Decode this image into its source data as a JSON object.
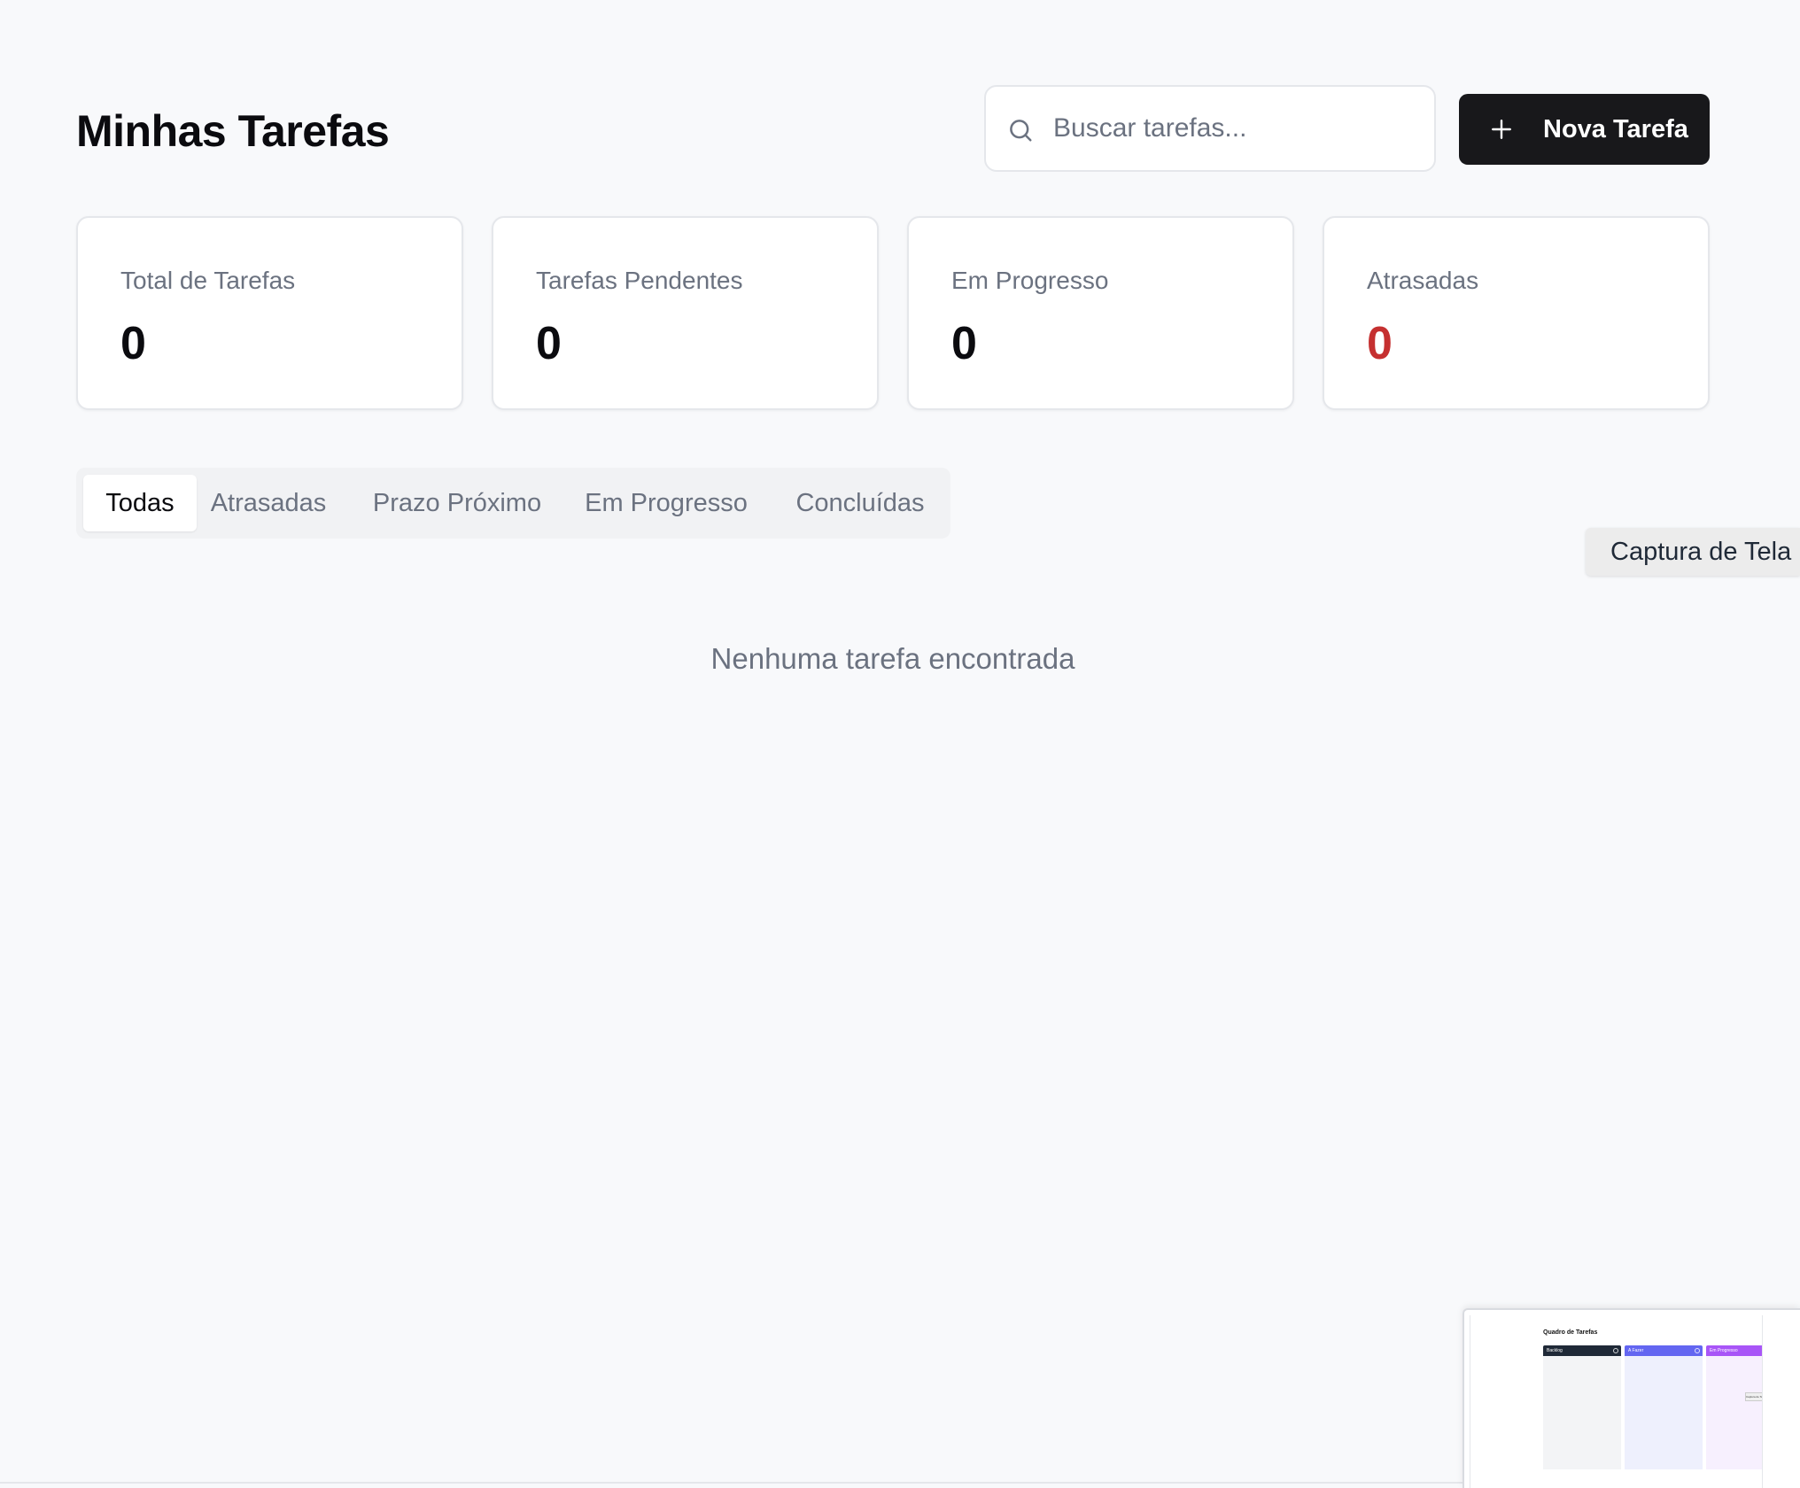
{
  "header": {
    "title": "Minhas Tarefas",
    "search_placeholder": "Buscar tarefas...",
    "search_value": "",
    "new_task_label": "Nova Tarefa"
  },
  "stats": [
    {
      "label": "Total de Tarefas",
      "value": "0"
    },
    {
      "label": "Tarefas Pendentes",
      "value": "0"
    },
    {
      "label": "Em Progresso",
      "value": "0"
    },
    {
      "label": "Atrasadas",
      "value": "0"
    }
  ],
  "tabs": [
    {
      "label": "Todas",
      "active": true
    },
    {
      "label": "Atrasadas",
      "active": false
    },
    {
      "label": "Prazo Próximo",
      "active": false
    },
    {
      "label": "Em Progresso",
      "active": false
    },
    {
      "label": "Concluídas",
      "active": false
    }
  ],
  "empty_state": "Nenhuma tarefa encontrada",
  "tooltip": "Captura de Tela",
  "thumbnail": {
    "title": "Quadro de Tarefas",
    "columns": [
      "Backlog",
      "A Fazer",
      "Em Progresso"
    ],
    "tooltip": "Captura de Tela"
  },
  "icons": {
    "search": "search-icon",
    "add": "plus-icon"
  },
  "colors": {
    "background": "#f8f9fb",
    "primary_button": "#18181b",
    "danger": "#c53030",
    "muted_text": "#6b7280",
    "thumb_backlog": "#1f2937",
    "thumb_todo": "#6366f1",
    "thumb_progress": "#a855f7"
  }
}
